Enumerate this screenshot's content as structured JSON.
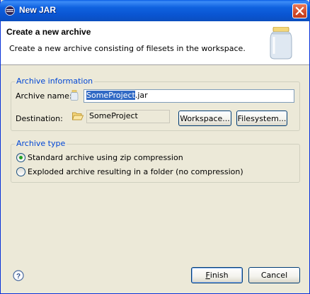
{
  "window": {
    "title": "New JAR"
  },
  "header": {
    "title": "Create a new archive",
    "description": "Create a new archive consisting of filesets in the workspace."
  },
  "archive_info": {
    "legend": "Archive information",
    "name_label": "Archive name:",
    "name_selected": "SomeProject",
    "name_rest": ".jar",
    "destination_label": "Destination:",
    "destination_value": "SomeProject",
    "workspace_button": "Workspace...",
    "filesystem_button": "Filesystem..."
  },
  "archive_type": {
    "legend": "Archive type",
    "options": [
      {
        "label": "Standard archive using zip compression",
        "selected": true
      },
      {
        "label": "Exploded archive resulting in a folder (no compression)",
        "selected": false
      }
    ]
  },
  "footer": {
    "finish_button_rest": "inish",
    "finish_button_mnemonic": "F",
    "cancel_button": "Cancel"
  },
  "colors": {
    "titlebar": "#0a55d2",
    "dialog_bg": "#ece9d8",
    "legend_text": "#0046d5",
    "selection": "#316ac5"
  }
}
